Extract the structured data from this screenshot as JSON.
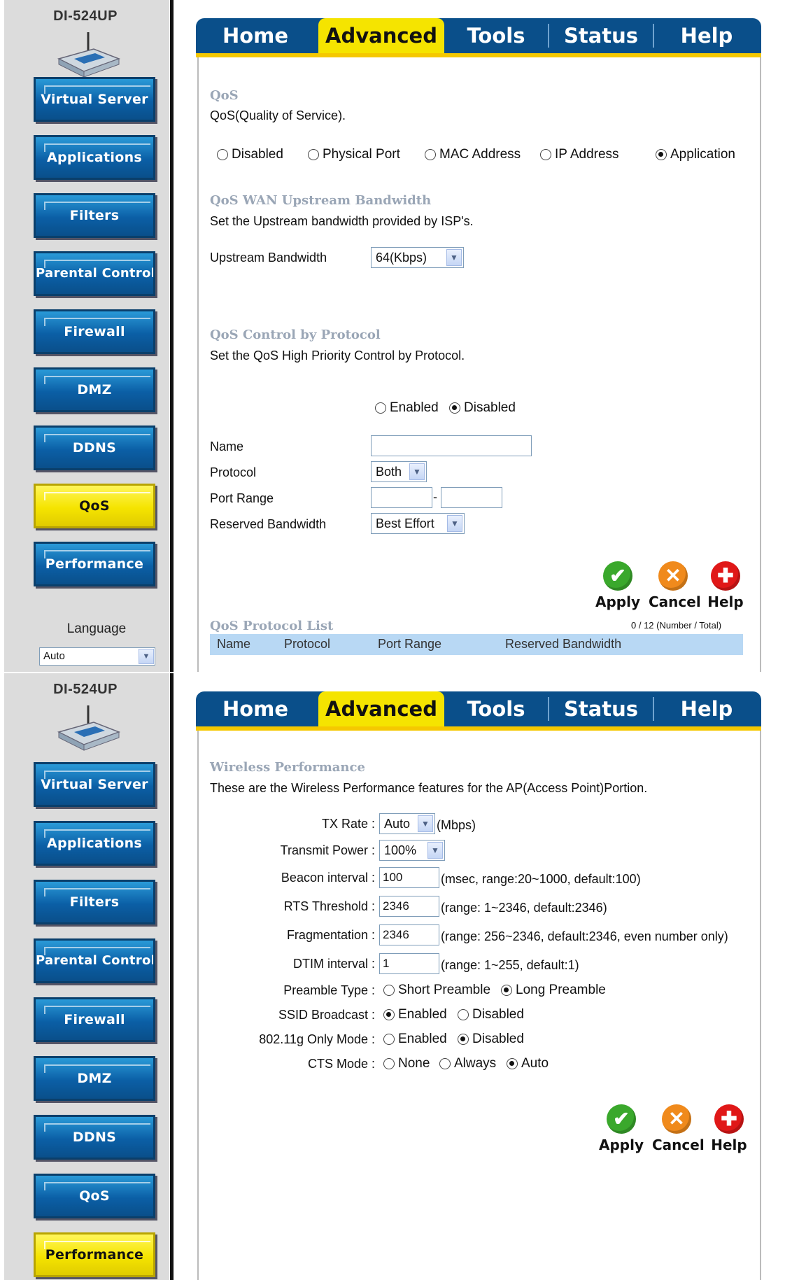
{
  "model": "DI-524UP",
  "tabs": [
    "Home",
    "Advanced",
    "Tools",
    "Status",
    "Help"
  ],
  "sidebar": [
    "Virtual Server",
    "Applications",
    "Filters",
    "Parental Control",
    "Firewall",
    "DMZ",
    "DDNS",
    "QoS",
    "Performance"
  ],
  "language": {
    "label": "Language",
    "value": "Auto"
  },
  "actions": {
    "apply": "Apply",
    "cancel": "Cancel",
    "help": "Help"
  },
  "qos": {
    "title": "QoS",
    "desc": "QoS(Quality of Service).",
    "modes": [
      "Disabled",
      "Physical Port",
      "MAC Address",
      "IP Address",
      "Application"
    ],
    "selected_mode": "Application",
    "wan": {
      "title": "QoS WAN Upstream Bandwidth",
      "desc": "Set the Upstream bandwidth provided by ISP's.",
      "label": "Upstream Bandwidth",
      "value": "64(Kbps)"
    },
    "protocol": {
      "title": "QoS Control by Protocol",
      "desc": "Set the QoS High Priority Control by Protocol.",
      "enabled": "Enabled",
      "disabled": "Disabled",
      "selected": "Disabled",
      "name_label": "Name",
      "protocol_label": "Protocol",
      "protocol_value": "Both",
      "port_label": "Port Range",
      "port_sep": "-",
      "reserved_label": "Reserved Bandwidth",
      "reserved_value": "Best Effort"
    },
    "list": {
      "title": "QoS Protocol List",
      "count": "0 / 12 (Number / Total)",
      "columns": [
        "Name",
        "Protocol",
        "Port Range",
        "Reserved Bandwidth"
      ]
    }
  },
  "performance": {
    "title": "Wireless Performance",
    "desc": "These are the Wireless Performance features for the AP(Access Point)Portion.",
    "tx_rate": {
      "label": "TX Rate :",
      "value": "Auto",
      "unit": "(Mbps)"
    },
    "tx_power": {
      "label": "Transmit Power :",
      "value": "100%"
    },
    "beacon": {
      "label": "Beacon interval :",
      "value": "100",
      "hint": "(msec, range:20~1000, default:100)"
    },
    "rts": {
      "label": "RTS Threshold :",
      "value": "2346",
      "hint": "(range: 1~2346, default:2346)"
    },
    "frag": {
      "label": "Fragmentation :",
      "value": "2346",
      "hint": "(range: 256~2346, default:2346, even number only)"
    },
    "dtim": {
      "label": "DTIM interval :",
      "value": "1",
      "hint": "(range: 1~255, default:1)"
    },
    "preamble": {
      "label": "Preamble Type :",
      "options": [
        "Short Preamble",
        "Long Preamble"
      ],
      "selected": "Long Preamble"
    },
    "ssid": {
      "label": "SSID Broadcast :",
      "options": [
        "Enabled",
        "Disabled"
      ],
      "selected": "Enabled"
    },
    "gmode": {
      "label": "802.11g Only Mode :",
      "options": [
        "Enabled",
        "Disabled"
      ],
      "selected": "Disabled"
    },
    "cts": {
      "label": "CTS Mode :",
      "options": [
        "None",
        "Always",
        "Auto"
      ],
      "selected": "Auto"
    }
  }
}
